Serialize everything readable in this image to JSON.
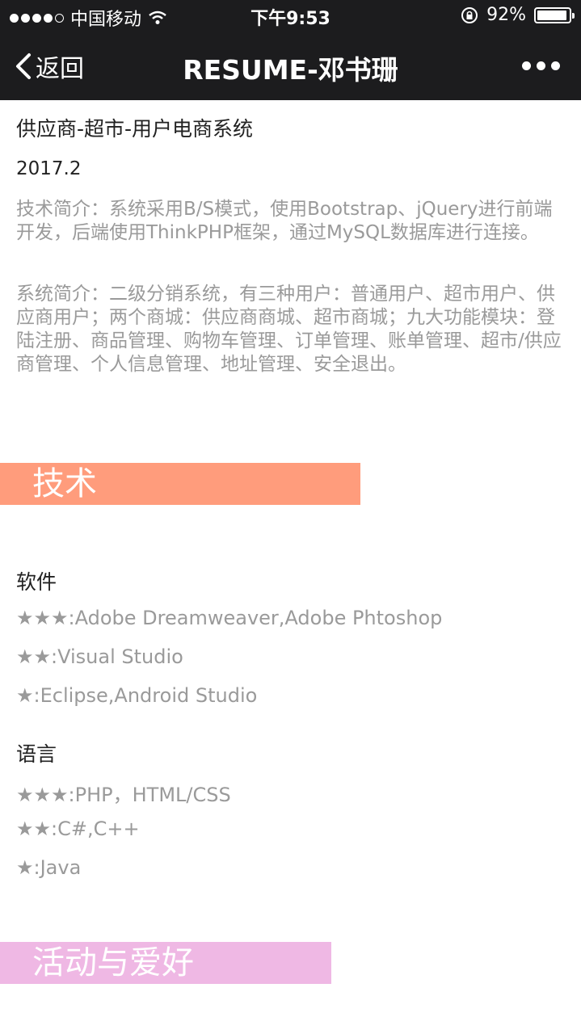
{
  "status": {
    "carrier": "中国移动",
    "time": "下午9:53",
    "battery": "92%"
  },
  "nav": {
    "back": "返回",
    "title": "RESUME-邓书珊"
  },
  "project": {
    "title": "供应商-超市-用户电商系统",
    "date": "2017.2",
    "tech_intro": "技术简介：系统采用B/S模式，使用Bootstrap、jQuery进行前端开发，后端使用ThinkPHP框架，通过MySQL数据库进行连接。",
    "sys_intro": "系统简介：二级分销系统，有三种用户：普通用户、超市用户、供应商用户；两个商城：供应商商城、超市商城；九大功能模块：登陆注册、商品管理、购物车管理、订单管理、账单管理、超市/供应商管理、个人信息管理、地址管理、安全退出。"
  },
  "tech_section": {
    "label": "技术",
    "color": "#ff9c7c",
    "software_title": "软件",
    "software": [
      {
        "stars": "★★★",
        "text": ":Adobe Dreamweaver,Adobe Phtoshop"
      },
      {
        "stars": "★★",
        "text": ":Visual Studio"
      },
      {
        "stars": "★",
        "text": ":Eclipse,Android Studio"
      }
    ],
    "language_title": "语言",
    "languages": [
      {
        "stars": "★★★",
        "text": ":PHP，HTML/CSS"
      },
      {
        "stars": "★★",
        "text": ":C#,C++"
      },
      {
        "stars": "★",
        "text": ":Java"
      }
    ]
  },
  "hobby_section": {
    "label": "活动与爱好",
    "color": "#efb8e4"
  }
}
